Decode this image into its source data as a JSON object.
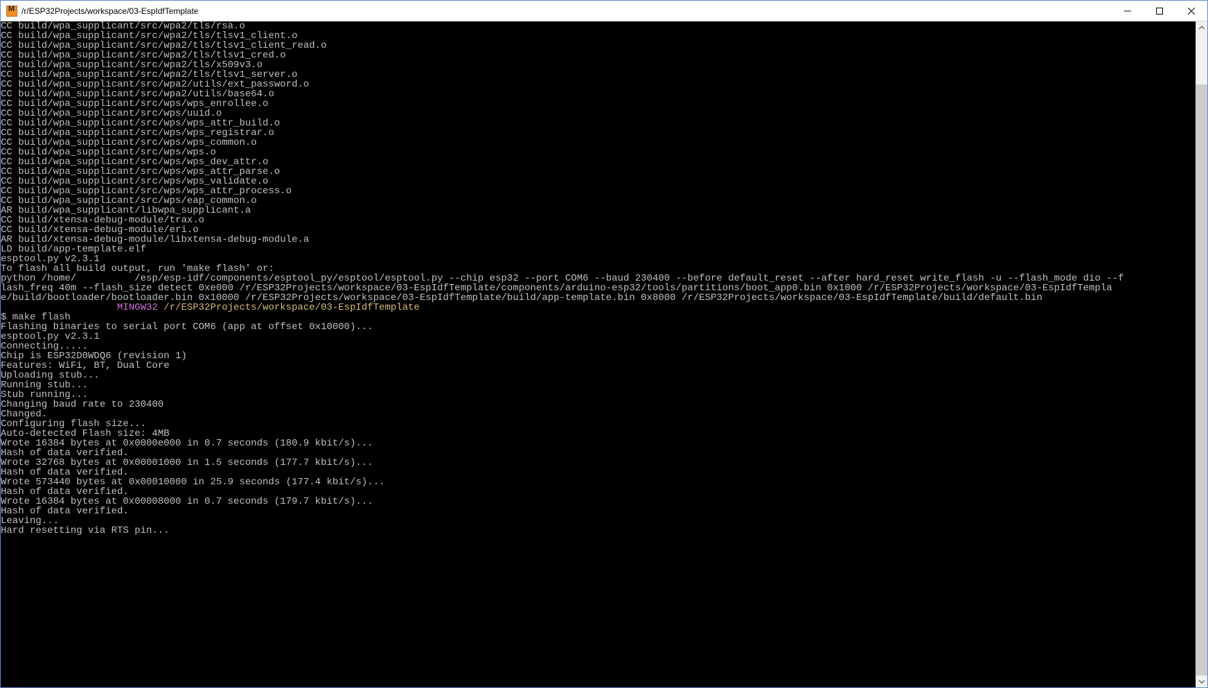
{
  "window": {
    "title": "/r/ESP32Projects/workspace/03-EspIdfTemplate",
    "icon_name": "mintty-icon"
  },
  "scrollbar": {
    "thumb_top_pct": 8,
    "thumb_height_pct": 92
  },
  "prompt": {
    "env": "MINGW32",
    "cwd": "/r/ESP32Projects/workspace/03-EspIdfTemplate",
    "symbol": "$",
    "command": "make flash"
  },
  "terminal_lines": [
    {
      "t": "CC build/wpa_supplicant/src/wpa2/tls/rsa.o"
    },
    {
      "t": "CC build/wpa_supplicant/src/wpa2/tls/tlsv1_client.o"
    },
    {
      "t": "CC build/wpa_supplicant/src/wpa2/tls/tlsv1_client_read.o"
    },
    {
      "t": "CC build/wpa_supplicant/src/wpa2/tls/tlsv1_cred.o"
    },
    {
      "t": "CC build/wpa_supplicant/src/wpa2/tls/x509v3.o"
    },
    {
      "t": "CC build/wpa_supplicant/src/wpa2/tls/tlsv1_server.o"
    },
    {
      "t": "CC build/wpa_supplicant/src/wpa2/utils/ext_password.o"
    },
    {
      "t": "CC build/wpa_supplicant/src/wpa2/utils/base64.o"
    },
    {
      "t": "CC build/wpa_supplicant/src/wps/wps_enrollee.o"
    },
    {
      "t": "CC build/wpa_supplicant/src/wps/uuid.o"
    },
    {
      "t": "CC build/wpa_supplicant/src/wps/wps_attr_build.o"
    },
    {
      "t": "CC build/wpa_supplicant/src/wps/wps_registrar.o"
    },
    {
      "t": "CC build/wpa_supplicant/src/wps/wps_common.o"
    },
    {
      "t": "CC build/wpa_supplicant/src/wps/wps.o"
    },
    {
      "t": "CC build/wpa_supplicant/src/wps/wps_dev_attr.o"
    },
    {
      "t": "CC build/wpa_supplicant/src/wps/wps_attr_parse.o"
    },
    {
      "t": "CC build/wpa_supplicant/src/wps/wps_validate.o"
    },
    {
      "t": "CC build/wpa_supplicant/src/wps/wps_attr_process.o"
    },
    {
      "t": "CC build/wpa_supplicant/src/wps/eap_common.o"
    },
    {
      "t": "AR build/wpa_supplicant/libwpa_supplicant.a"
    },
    {
      "t": "CC build/xtensa-debug-module/trax.o"
    },
    {
      "t": "CC build/xtensa-debug-module/eri.o"
    },
    {
      "t": "AR build/xtensa-debug-module/libxtensa-debug-module.a"
    },
    {
      "t": "LD build/app-template.elf"
    },
    {
      "t": "esptool.py v2.3.1"
    },
    {
      "t": "To flash all build output, run 'make flash' or:"
    },
    {
      "t": "python /home/          /esp/esp-idf/components/esptool_py/esptool/esptool.py --chip esp32 --port COM6 --baud 230400 --before default_reset --after hard_reset write_flash -u --flash_mode dio --f"
    },
    {
      "t": "lash_freq 40m --flash_size detect 0xe000 /r/ESP32Projects/workspace/03-EspIdfTemplate/components/arduino-esp32/tools/partitions/boot_app0.bin 0x1000 /r/ESP32Projects/workspace/03-EspIdfTempla"
    },
    {
      "t": "e/build/bootloader/bootloader.bin 0x10000 /r/ESP32Projects/workspace/03-EspIdfTemplate/build/app-template.bin 0x8000 /r/ESP32Projects/workspace/03-EspIdfTemplate/build/default.bin"
    },
    {
      "t": ""
    },
    {
      "prompt": true
    },
    {
      "cmd": true
    },
    {
      "t": "Flashing binaries to serial port COM6 (app at offset 0x10000)..."
    },
    {
      "t": "esptool.py v2.3.1"
    },
    {
      "t": "Connecting....."
    },
    {
      "t": "Chip is ESP32D0WDQ6 (revision 1)"
    },
    {
      "t": "Features: WiFi, BT, Dual Core"
    },
    {
      "t": "Uploading stub..."
    },
    {
      "t": "Running stub..."
    },
    {
      "t": "Stub running..."
    },
    {
      "t": "Changing baud rate to 230400"
    },
    {
      "t": "Changed."
    },
    {
      "t": "Configuring flash size..."
    },
    {
      "t": "Auto-detected Flash size: 4MB"
    },
    {
      "t": "Wrote 16384 bytes at 0x0000e000 in 0.7 seconds (180.9 kbit/s)..."
    },
    {
      "t": "Hash of data verified."
    },
    {
      "t": "Wrote 32768 bytes at 0x00001000 in 1.5 seconds (177.7 kbit/s)..."
    },
    {
      "t": "Hash of data verified."
    },
    {
      "t": "Wrote 573440 bytes at 0x00010000 in 25.9 seconds (177.4 kbit/s)..."
    },
    {
      "t": "Hash of data verified."
    },
    {
      "t": "Wrote 16384 bytes at 0x00008000 in 0.7 seconds (179.7 kbit/s)..."
    },
    {
      "t": "Hash of data verified."
    },
    {
      "t": ""
    },
    {
      "t": "Leaving..."
    },
    {
      "t": "Hard resetting via RTS pin..."
    }
  ]
}
